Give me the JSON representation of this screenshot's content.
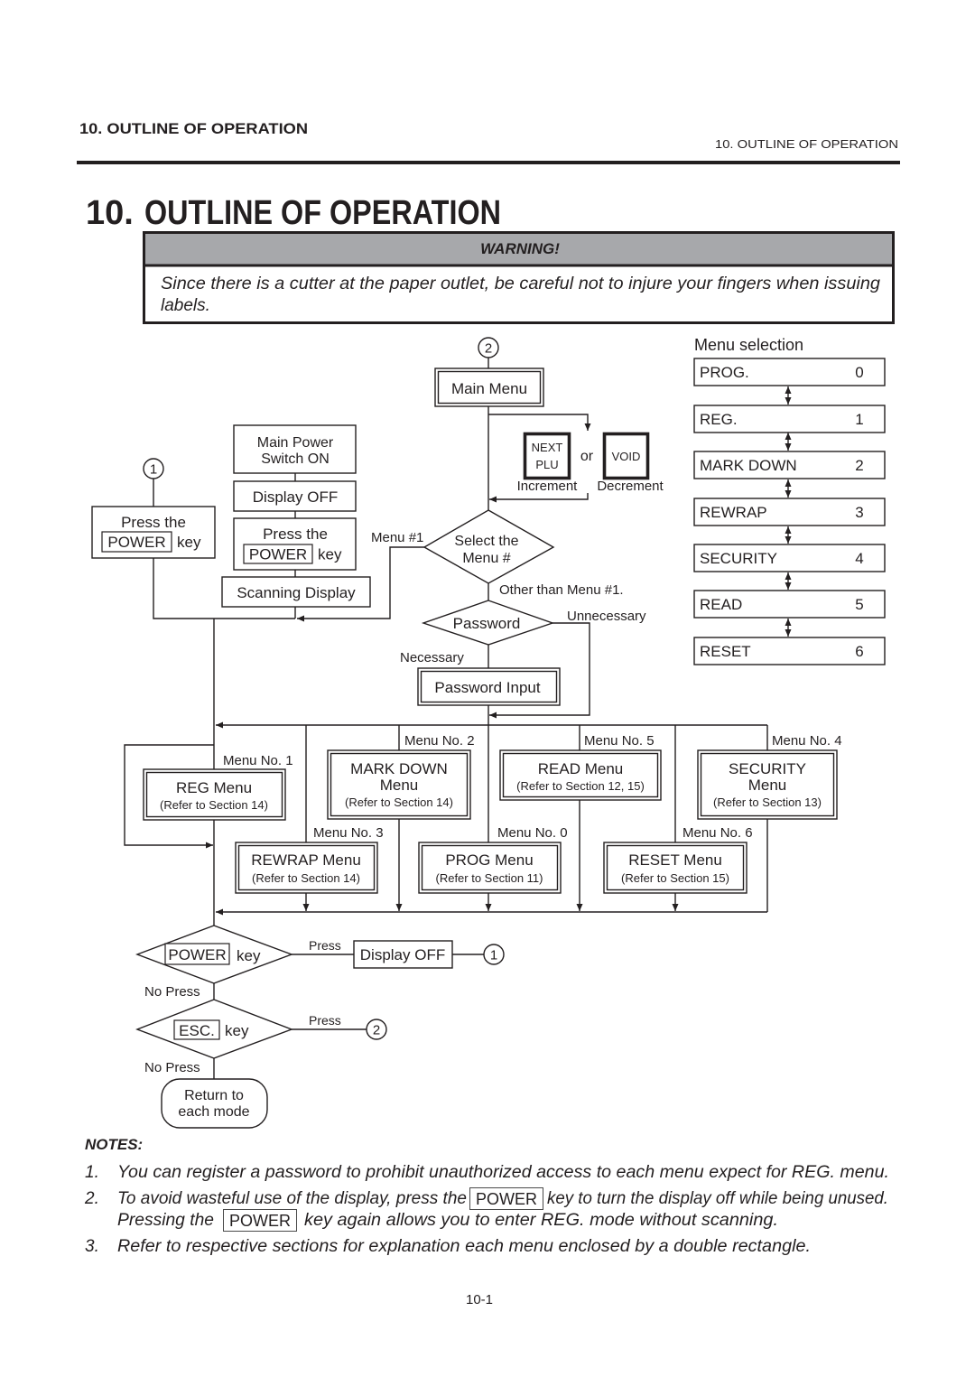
{
  "header": {
    "running_title_left": "10. OUTLINE OF OPERATION",
    "running_title_right": "10. OUTLINE OF OPERATION"
  },
  "title": {
    "number": "10.",
    "text": "OUTLINE OF OPERATION"
  },
  "warning": {
    "heading": "WARNING!",
    "body_lines": [
      "Since there is a cutter at the paper outlet, be careful not to injure your fingers when issuing",
      "labels."
    ],
    "band_color": "#a7a8ab"
  },
  "flowchart": {
    "connector_1": "1",
    "connector_2": "2",
    "power_on": {
      "main_power_lines": [
        "Main Power",
        "Switch ON"
      ],
      "display_off": "Display OFF",
      "press_the": "Press the",
      "power_key": "POWER",
      "key": "key",
      "scanning_display": "Scanning Display"
    },
    "resume": {
      "press_the": "Press the",
      "power_key": "POWER",
      "key": "key"
    },
    "main_menu": "Main Menu",
    "nav_keys": {
      "next_plu_lines": [
        "NEXT",
        "PLU"
      ],
      "or": "or",
      "void": "VOID",
      "increment": "Increment",
      "decrement": "Decrement"
    },
    "select_menu": {
      "lines": [
        "Select the",
        "Menu #"
      ],
      "menu1_branch": "Menu #1",
      "other_branch": "Other than Menu #1."
    },
    "password": {
      "decision": "Password",
      "unnecessary": "Unnecessary",
      "necessary": "Necessary",
      "input": "Password Input"
    },
    "menus": {
      "reg": {
        "number_label": "Menu No. 1",
        "title_lines": [
          "REG Menu"
        ],
        "reference": "(Refer to Section 14)"
      },
      "mark_down": {
        "number_label": "Menu No. 2",
        "title_lines": [
          "MARK DOWN",
          "Menu"
        ],
        "reference": "(Refer to Section 14)"
      },
      "rewrap": {
        "number_label": "Menu No. 3",
        "title_lines": [
          "REWRAP Menu"
        ],
        "reference": "(Refer to Section 14)"
      },
      "security": {
        "number_label": "Menu No. 4",
        "title_lines": [
          "SECURITY",
          "Menu"
        ],
        "reference": "(Refer to Section 13)"
      },
      "read": {
        "number_label": "Menu No. 5",
        "title_lines": [
          "READ Menu"
        ],
        "reference": "(Refer to Section 12, 15)"
      },
      "prog": {
        "number_label": "Menu No. 0",
        "title_lines": [
          "PROG Menu"
        ],
        "reference": "(Refer to Section 11)"
      },
      "reset": {
        "number_label": "Menu No. 6",
        "title_lines": [
          "RESET Menu"
        ],
        "reference": "(Refer to Section 15)"
      }
    },
    "exit": {
      "power_key": "POWER",
      "key": "key",
      "press": "Press",
      "no_press": "No Press",
      "display_off": "Display OFF",
      "esc_key": "ESC.",
      "return_lines": [
        "Return to",
        "each mode"
      ]
    }
  },
  "menu_selection": {
    "title": "Menu selection",
    "items": [
      {
        "label": "PROG.",
        "number": "0"
      },
      {
        "label": "REG.",
        "number": "1"
      },
      {
        "label": "MARK DOWN",
        "number": "2"
      },
      {
        "label": "REWRAP",
        "number": "3"
      },
      {
        "label": "SECURITY",
        "number": "4"
      },
      {
        "label": "READ",
        "number": "5"
      },
      {
        "label": "RESET",
        "number": "6"
      }
    ]
  },
  "notes": {
    "heading": "NOTES:",
    "items": [
      {
        "number": "1.",
        "text": "You can register a password to prohibit unauthorized access to each menu expect for REG. menu."
      },
      {
        "number": "2.",
        "line1_before": "To avoid wasteful use of the display, press the",
        "line1_key": "POWER",
        "line1_after": "key to turn the display off while being unused.",
        "line2_before": "Pressing the",
        "line2_key": "POWER",
        "line2_after": "key again allows you to enter REG. mode without scanning."
      },
      {
        "number": "3.",
        "text": "Refer to respective sections for explanation each menu enclosed by a double rectangle."
      }
    ]
  },
  "footer": {
    "page_number": "10-1"
  }
}
